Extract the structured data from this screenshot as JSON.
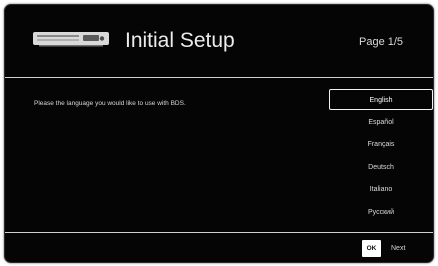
{
  "header": {
    "icon": "disc-player-icon",
    "title": "Initial Setup",
    "page_indicator": "Page 1/5"
  },
  "prompt": "Please the language you would like to use with BDS.",
  "languages": [
    {
      "label": "English",
      "selected": true
    },
    {
      "label": "Español",
      "selected": false
    },
    {
      "label": "Français",
      "selected": false
    },
    {
      "label": "Deutsch",
      "selected": false
    },
    {
      "label": "Italiano",
      "selected": false
    },
    {
      "label": "Русский",
      "selected": false
    }
  ],
  "footer": {
    "ok_key": "OK",
    "next_label": "Next"
  },
  "colors": {
    "background": "#050505",
    "text": "#dcdcdc",
    "highlight": "#ffffff"
  }
}
